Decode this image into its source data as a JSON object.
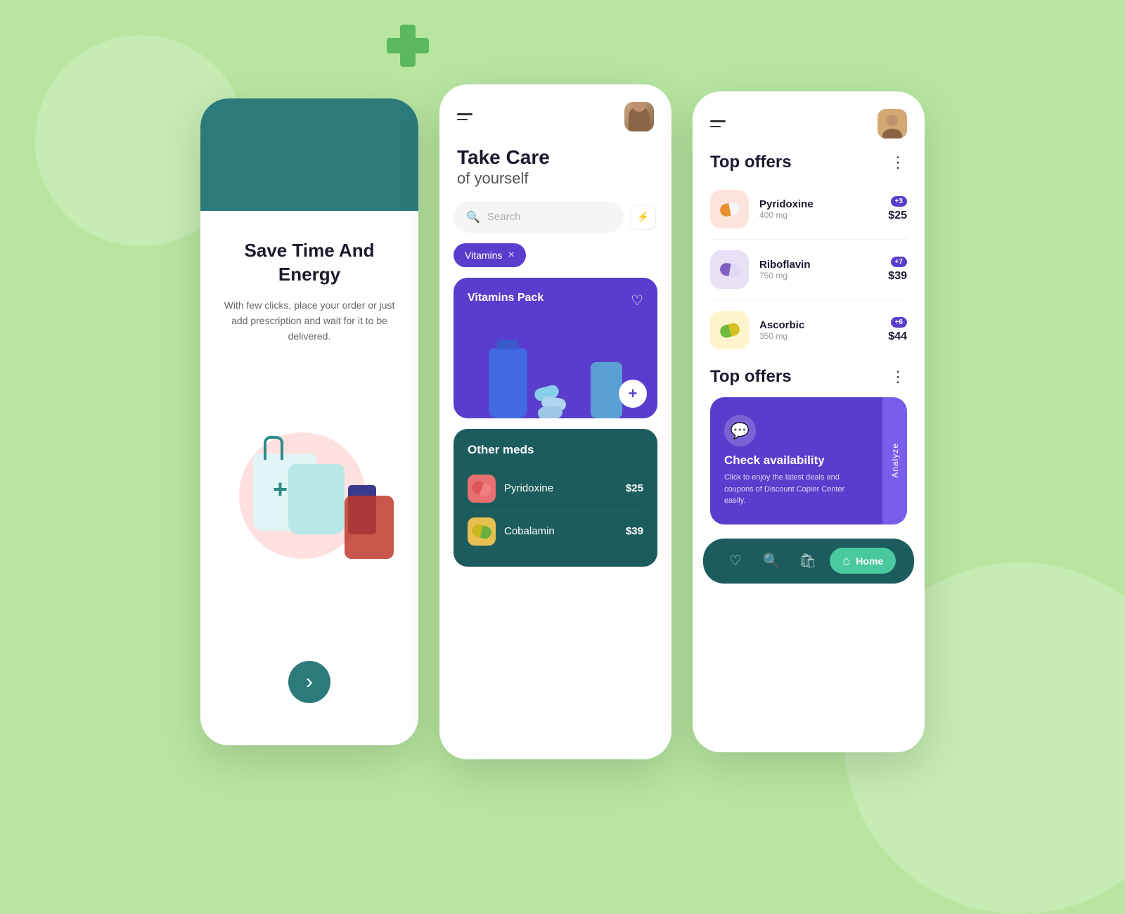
{
  "background": {
    "color": "#b8e6a0"
  },
  "phone1": {
    "title": "Save Time And Energy",
    "description": "With few clicks, place your order or just add prescription and wait for it to be delivered.",
    "next_button_label": "›"
  },
  "phone2": {
    "header": {
      "menu_label": "Menu",
      "avatar_alt": "User Avatar"
    },
    "greeting": {
      "line1": "Take Care",
      "line2": "of yourself"
    },
    "search": {
      "placeholder": "Search"
    },
    "tag": {
      "label": "Vitamins",
      "remove": "×"
    },
    "vitamins_card": {
      "title": "Vitamins Pack",
      "heart_icon": "♡",
      "add_icon": "+"
    },
    "other_meds": {
      "title": "Other meds",
      "items": [
        {
          "name": "Pyridoxine",
          "price": "$25",
          "icon_type": "red"
        },
        {
          "name": "Cobalamin",
          "price": "$39",
          "icon_type": "yellow"
        }
      ]
    }
  },
  "phone3": {
    "header": {
      "menu_label": "Menu",
      "avatar_alt": "User Avatar"
    },
    "top_offers_1": {
      "title": "Top offers",
      "items": [
        {
          "name": "Pyridoxine",
          "mg": "400 mg",
          "badge": "+3",
          "price": "$25",
          "icon_type": "pink"
        },
        {
          "name": "Riboflavin",
          "mg": "750 mg",
          "badge": "+7",
          "price": "$39",
          "icon_type": "purple"
        },
        {
          "name": "Ascorbic",
          "mg": "350 mg",
          "badge": "+6",
          "price": "$44",
          "icon_type": "yellow"
        }
      ]
    },
    "top_offers_2": {
      "title": "Top offers",
      "card": {
        "title": "Check availability",
        "description": "Click to enjoy the latest deals and coupons of Discount Copier Center easily.",
        "analyze_label": "Analyze"
      }
    },
    "bottom_nav": {
      "heart_label": "Favorites",
      "search_label": "Search",
      "bag_label": "Cart",
      "home_label": "Home"
    }
  }
}
